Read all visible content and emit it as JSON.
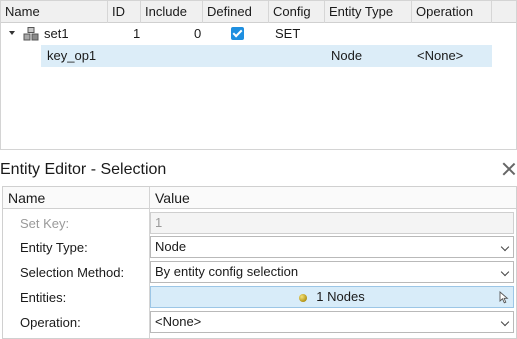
{
  "tree": {
    "columns": [
      "Name",
      "ID",
      "Include",
      "Defined",
      "Config",
      "Entity Type",
      "Operation"
    ],
    "rows": [
      {
        "name": "set1",
        "id": "1",
        "include": "0",
        "defined": true,
        "config": "SET",
        "entity_type": "",
        "operation": ""
      },
      {
        "name": "key_op1",
        "id": "",
        "include": "",
        "defined": false,
        "config": "",
        "entity_type": "Node",
        "operation": "<None>"
      }
    ]
  },
  "editor": {
    "title": "Entity Editor - Selection",
    "header_name": "Name",
    "header_value": "Value",
    "set_key_label": "Set Key:",
    "set_key_value": "1",
    "entity_type_label": "Entity Type:",
    "entity_type_value": "Node",
    "selection_method_label": "Selection Method:",
    "selection_method_value": "By entity config selection",
    "entities_label": "Entities:",
    "entities_value": "1 Nodes",
    "operation_label": "Operation:",
    "operation_value": "<None>"
  },
  "icons": {
    "expand": "chevron-down-icon",
    "set": "set-group-icon",
    "checkbox": "checkbox-checked-icon",
    "node": "node-icon",
    "cursor": "cursor-icon",
    "close": "close-icon",
    "dropdown": "chevron-down-icon"
  },
  "colors": {
    "accent": "#1e8fe0",
    "selected_row": "#dcedf8",
    "entities_field": "#d8ecf9"
  }
}
